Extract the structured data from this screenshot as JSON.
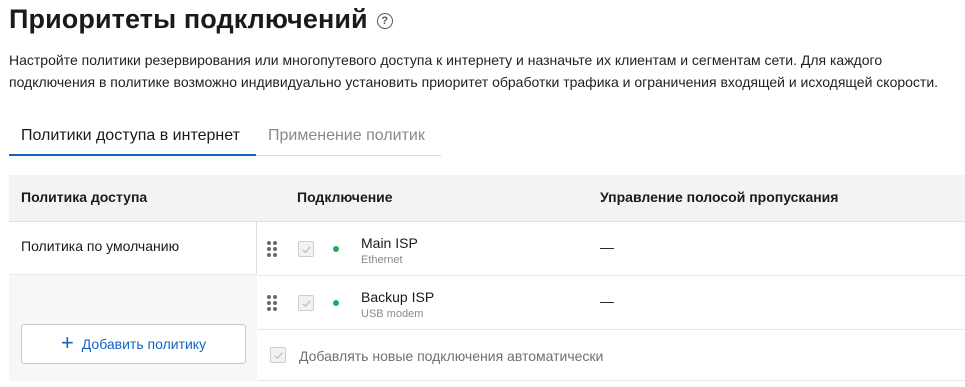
{
  "page": {
    "title": "Приоритеты подключений",
    "help_icon": "question-circle-icon",
    "description": "Настройте политики резервирования или многопутевого доступа к интернету и назначьте их клиентам и сегментам сети. Для каждого подключения в политике возможно индивидуально установить приоритет обработки трафика и ограничения входящей и исходящей скорости."
  },
  "tabs": [
    {
      "label": "Политики доступа в интернет",
      "active": true
    },
    {
      "label": "Применение политик",
      "active": false
    }
  ],
  "table": {
    "headers": {
      "policy": "Политика доступа",
      "connection": "Подключение",
      "bandwidth": "Управление полосой пропускания"
    },
    "policies": [
      {
        "name": "Политика по умолчанию"
      }
    ],
    "add_policy_label": "Добавить политику",
    "connections": [
      {
        "name": "Main ISP",
        "type": "Ethernet",
        "bandwidth": "—",
        "status_color": "#1fae5b",
        "checked": true
      },
      {
        "name": "Backup ISP",
        "type": "USB modem",
        "bandwidth": "—",
        "status_color": "#1fae5b",
        "checked": true
      }
    ],
    "auto_add_label": "Добавлять новые подключения автоматически",
    "auto_add_checked": true
  },
  "colors": {
    "accent": "#1565c0",
    "status_online": "#1fae5b"
  }
}
